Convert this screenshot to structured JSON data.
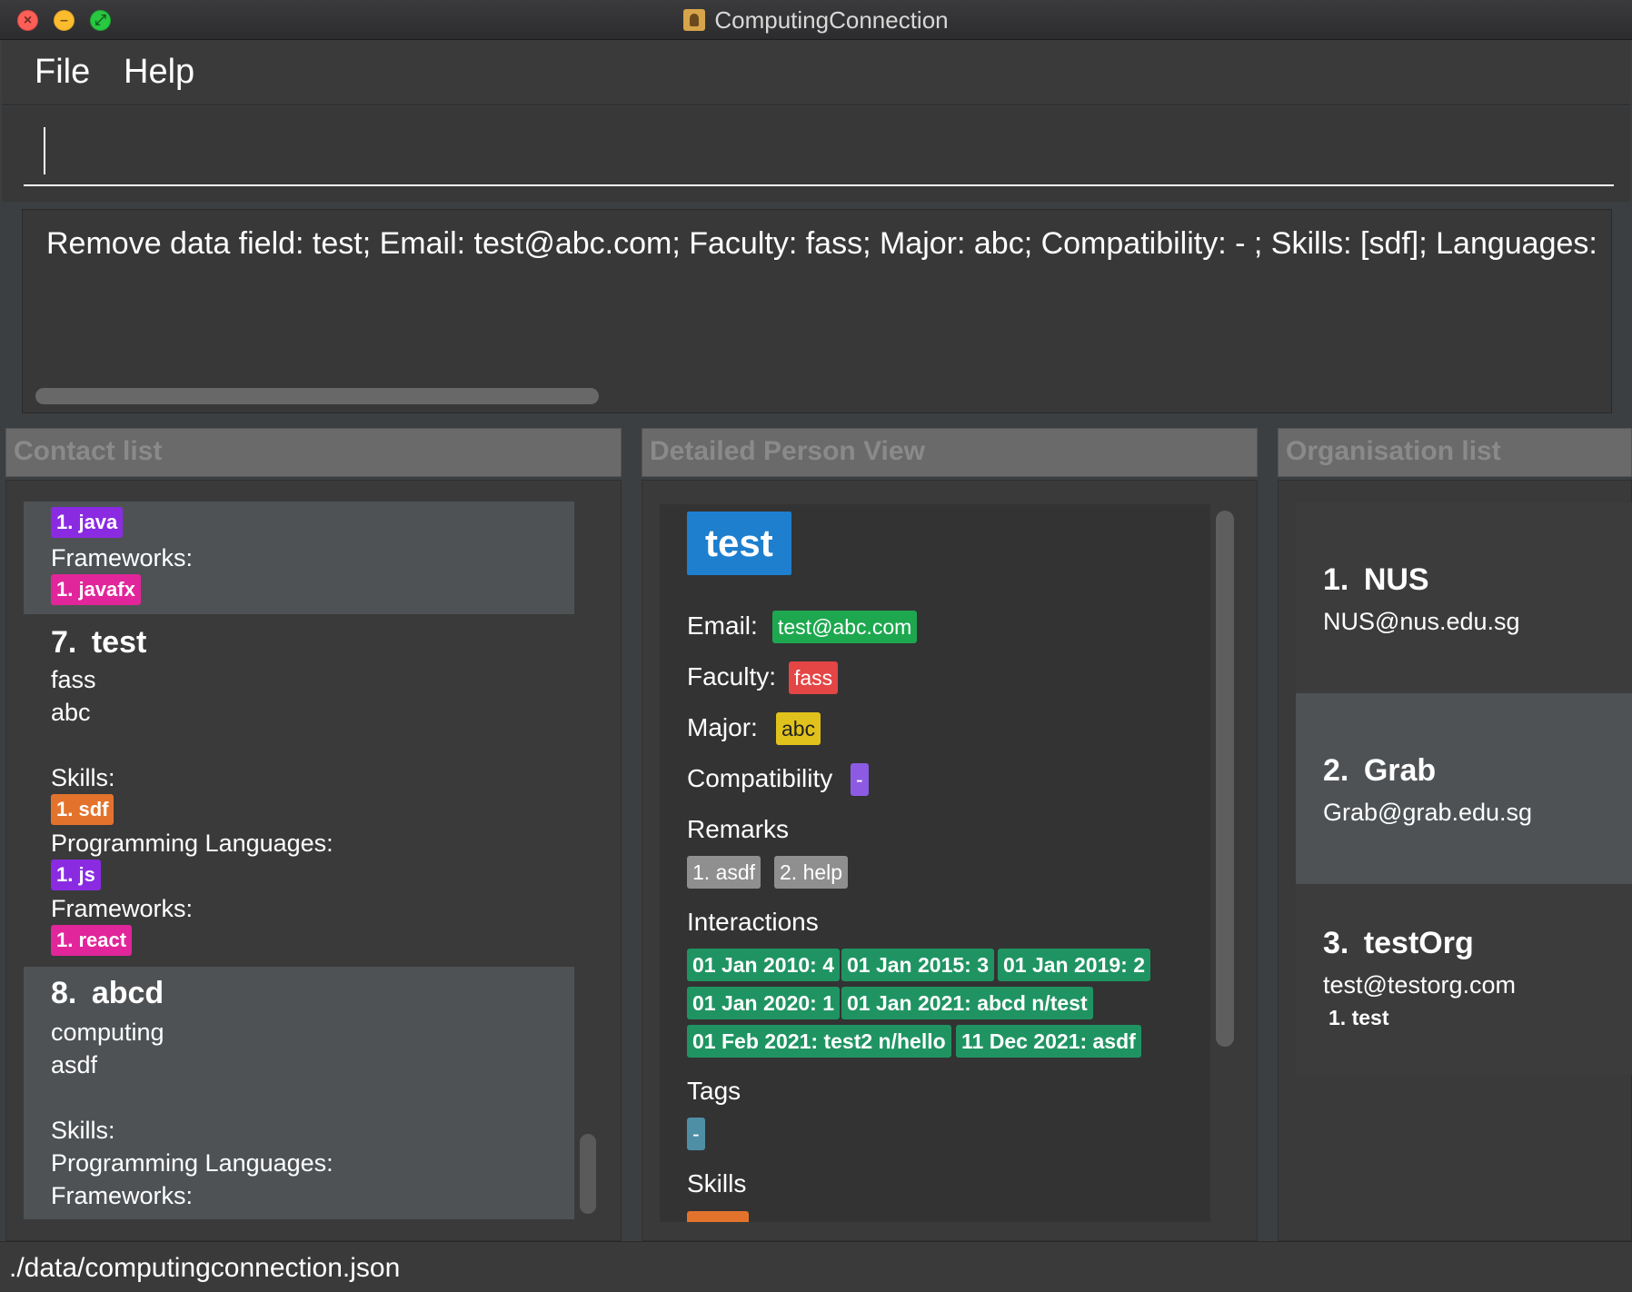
{
  "window": {
    "title": "ComputingConnection"
  },
  "menu": {
    "file": "File",
    "help": "Help"
  },
  "command": {
    "value": ""
  },
  "result": {
    "text": "Remove data field: test; Email: test@abc.com; Faculty: fass; Major: abc; Compatibility:  - ; Skills: [sdf]; Languages:"
  },
  "panes": {
    "contacts": "Contact list",
    "detail": "Detailed Person View",
    "orgs": "Organisation list"
  },
  "contacts": {
    "partial": {
      "lang": "1. java",
      "frameworks_label": "Frameworks:",
      "framework": "1. javafx"
    },
    "items": [
      {
        "index": "7.",
        "name": "test",
        "faculty": "fass",
        "major": "abc",
        "skills_label": "Skills:",
        "skill": "1. sdf",
        "langs_label": "Programming Languages:",
        "lang": "1. js",
        "frameworks_label": "Frameworks:",
        "framework": "1. react"
      },
      {
        "index": "8.",
        "name": "abcd",
        "faculty": "computing",
        "major": "asdf",
        "skills_label": "Skills:",
        "langs_label": "Programming Languages:",
        "frameworks_label": "Frameworks:"
      }
    ]
  },
  "detail": {
    "name": "test",
    "email_label": "Email:",
    "email": "test@abc.com",
    "faculty_label": "Faculty:",
    "faculty": "fass",
    "major_label": "Major:",
    "major": "abc",
    "compat_label": "Compatibility",
    "compat": "-",
    "remarks_label": "Remarks",
    "remarks": [
      "1. asdf",
      "2. help"
    ],
    "interactions_label": "Interactions",
    "interactions": [
      "01 Jan 2010: 4",
      "01 Jan 2015: 3",
      "01 Jan 2019: 2",
      "01 Jan 2020: 1",
      "01 Jan 2021: abcd n/test",
      "01 Feb 2021: test2 n/hello",
      "11 Dec 2021: asdf"
    ],
    "tags_label": "Tags",
    "tag": "-",
    "skills_label": "Skills"
  },
  "orgs": [
    {
      "index": "1.",
      "name": "NUS",
      "email": "NUS@nus.edu.sg"
    },
    {
      "index": "2.",
      "name": "Grab",
      "email": "Grab@grab.edu.sg"
    },
    {
      "index": "3.",
      "name": "testOrg",
      "email": "test@testorg.com",
      "member": "1. test"
    }
  ],
  "status": {
    "path": "./data/computingconnection.json"
  },
  "colors": {
    "email_chip": "#1da84f",
    "faculty_chip": "#e44545",
    "major_chip": "#e1c21d",
    "compat_chip": "#8d5be3",
    "name_badge": "#1e7fcf",
    "interaction_chip": "#1f9462"
  }
}
